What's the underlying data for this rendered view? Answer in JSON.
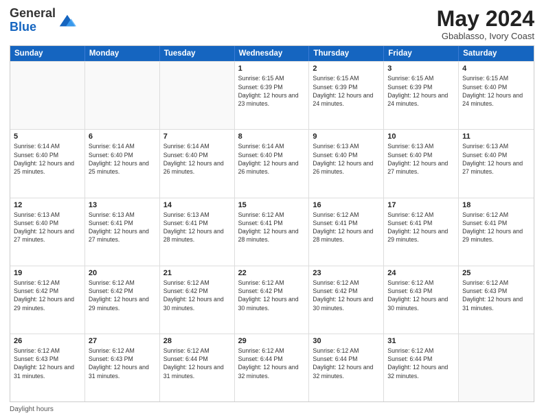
{
  "header": {
    "logo_general": "General",
    "logo_blue": "Blue",
    "month_title": "May 2024",
    "location": "Gbablasso, Ivory Coast"
  },
  "weekdays": [
    "Sunday",
    "Monday",
    "Tuesday",
    "Wednesday",
    "Thursday",
    "Friday",
    "Saturday"
  ],
  "footer_label": "Daylight hours",
  "weeks": [
    [
      {
        "day": "",
        "sunrise": "",
        "sunset": "",
        "daylight": "",
        "empty": true
      },
      {
        "day": "",
        "sunrise": "",
        "sunset": "",
        "daylight": "",
        "empty": true
      },
      {
        "day": "",
        "sunrise": "",
        "sunset": "",
        "daylight": "",
        "empty": true
      },
      {
        "day": "1",
        "sunrise": "Sunrise: 6:15 AM",
        "sunset": "Sunset: 6:39 PM",
        "daylight": "Daylight: 12 hours and 23 minutes."
      },
      {
        "day": "2",
        "sunrise": "Sunrise: 6:15 AM",
        "sunset": "Sunset: 6:39 PM",
        "daylight": "Daylight: 12 hours and 24 minutes."
      },
      {
        "day": "3",
        "sunrise": "Sunrise: 6:15 AM",
        "sunset": "Sunset: 6:39 PM",
        "daylight": "Daylight: 12 hours and 24 minutes."
      },
      {
        "day": "4",
        "sunrise": "Sunrise: 6:15 AM",
        "sunset": "Sunset: 6:40 PM",
        "daylight": "Daylight: 12 hours and 24 minutes."
      }
    ],
    [
      {
        "day": "5",
        "sunrise": "Sunrise: 6:14 AM",
        "sunset": "Sunset: 6:40 PM",
        "daylight": "Daylight: 12 hours and 25 minutes."
      },
      {
        "day": "6",
        "sunrise": "Sunrise: 6:14 AM",
        "sunset": "Sunset: 6:40 PM",
        "daylight": "Daylight: 12 hours and 25 minutes."
      },
      {
        "day": "7",
        "sunrise": "Sunrise: 6:14 AM",
        "sunset": "Sunset: 6:40 PM",
        "daylight": "Daylight: 12 hours and 26 minutes."
      },
      {
        "day": "8",
        "sunrise": "Sunrise: 6:14 AM",
        "sunset": "Sunset: 6:40 PM",
        "daylight": "Daylight: 12 hours and 26 minutes."
      },
      {
        "day": "9",
        "sunrise": "Sunrise: 6:13 AM",
        "sunset": "Sunset: 6:40 PM",
        "daylight": "Daylight: 12 hours and 26 minutes."
      },
      {
        "day": "10",
        "sunrise": "Sunrise: 6:13 AM",
        "sunset": "Sunset: 6:40 PM",
        "daylight": "Daylight: 12 hours and 27 minutes."
      },
      {
        "day": "11",
        "sunrise": "Sunrise: 6:13 AM",
        "sunset": "Sunset: 6:40 PM",
        "daylight": "Daylight: 12 hours and 27 minutes."
      }
    ],
    [
      {
        "day": "12",
        "sunrise": "Sunrise: 6:13 AM",
        "sunset": "Sunset: 6:40 PM",
        "daylight": "Daylight: 12 hours and 27 minutes."
      },
      {
        "day": "13",
        "sunrise": "Sunrise: 6:13 AM",
        "sunset": "Sunset: 6:41 PM",
        "daylight": "Daylight: 12 hours and 27 minutes."
      },
      {
        "day": "14",
        "sunrise": "Sunrise: 6:13 AM",
        "sunset": "Sunset: 6:41 PM",
        "daylight": "Daylight: 12 hours and 28 minutes."
      },
      {
        "day": "15",
        "sunrise": "Sunrise: 6:12 AM",
        "sunset": "Sunset: 6:41 PM",
        "daylight": "Daylight: 12 hours and 28 minutes."
      },
      {
        "day": "16",
        "sunrise": "Sunrise: 6:12 AM",
        "sunset": "Sunset: 6:41 PM",
        "daylight": "Daylight: 12 hours and 28 minutes."
      },
      {
        "day": "17",
        "sunrise": "Sunrise: 6:12 AM",
        "sunset": "Sunset: 6:41 PM",
        "daylight": "Daylight: 12 hours and 29 minutes."
      },
      {
        "day": "18",
        "sunrise": "Sunrise: 6:12 AM",
        "sunset": "Sunset: 6:41 PM",
        "daylight": "Daylight: 12 hours and 29 minutes."
      }
    ],
    [
      {
        "day": "19",
        "sunrise": "Sunrise: 6:12 AM",
        "sunset": "Sunset: 6:42 PM",
        "daylight": "Daylight: 12 hours and 29 minutes."
      },
      {
        "day": "20",
        "sunrise": "Sunrise: 6:12 AM",
        "sunset": "Sunset: 6:42 PM",
        "daylight": "Daylight: 12 hours and 29 minutes."
      },
      {
        "day": "21",
        "sunrise": "Sunrise: 6:12 AM",
        "sunset": "Sunset: 6:42 PM",
        "daylight": "Daylight: 12 hours and 30 minutes."
      },
      {
        "day": "22",
        "sunrise": "Sunrise: 6:12 AM",
        "sunset": "Sunset: 6:42 PM",
        "daylight": "Daylight: 12 hours and 30 minutes."
      },
      {
        "day": "23",
        "sunrise": "Sunrise: 6:12 AM",
        "sunset": "Sunset: 6:42 PM",
        "daylight": "Daylight: 12 hours and 30 minutes."
      },
      {
        "day": "24",
        "sunrise": "Sunrise: 6:12 AM",
        "sunset": "Sunset: 6:43 PM",
        "daylight": "Daylight: 12 hours and 30 minutes."
      },
      {
        "day": "25",
        "sunrise": "Sunrise: 6:12 AM",
        "sunset": "Sunset: 6:43 PM",
        "daylight": "Daylight: 12 hours and 31 minutes."
      }
    ],
    [
      {
        "day": "26",
        "sunrise": "Sunrise: 6:12 AM",
        "sunset": "Sunset: 6:43 PM",
        "daylight": "Daylight: 12 hours and 31 minutes."
      },
      {
        "day": "27",
        "sunrise": "Sunrise: 6:12 AM",
        "sunset": "Sunset: 6:43 PM",
        "daylight": "Daylight: 12 hours and 31 minutes."
      },
      {
        "day": "28",
        "sunrise": "Sunrise: 6:12 AM",
        "sunset": "Sunset: 6:44 PM",
        "daylight": "Daylight: 12 hours and 31 minutes."
      },
      {
        "day": "29",
        "sunrise": "Sunrise: 6:12 AM",
        "sunset": "Sunset: 6:44 PM",
        "daylight": "Daylight: 12 hours and 32 minutes."
      },
      {
        "day": "30",
        "sunrise": "Sunrise: 6:12 AM",
        "sunset": "Sunset: 6:44 PM",
        "daylight": "Daylight: 12 hours and 32 minutes."
      },
      {
        "day": "31",
        "sunrise": "Sunrise: 6:12 AM",
        "sunset": "Sunset: 6:44 PM",
        "daylight": "Daylight: 12 hours and 32 minutes."
      },
      {
        "day": "",
        "sunrise": "",
        "sunset": "",
        "daylight": "",
        "empty": true
      }
    ]
  ]
}
